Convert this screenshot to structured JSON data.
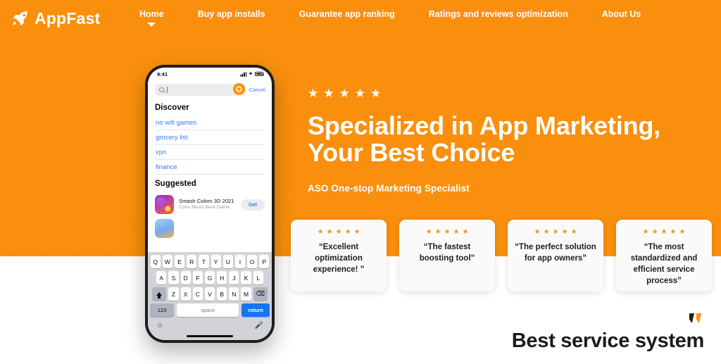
{
  "brand": {
    "name": "AppFast",
    "icon": "rocket-icon",
    "color": "#ffffff"
  },
  "theme": {
    "orange": "#f98f0c",
    "card_star": "#f9940f",
    "ios_blue": "#3a7afe",
    "return_key": "#1277f2"
  },
  "nav": {
    "items": [
      {
        "label": "Home",
        "has_caret": true
      },
      {
        "label": "Buy app installs",
        "has_caret": false
      },
      {
        "label": "Guarantee app ranking",
        "has_caret": false
      },
      {
        "label": "Ratings and reviews optimization",
        "has_caret": false
      },
      {
        "label": "About Us",
        "has_caret": false
      }
    ]
  },
  "hero": {
    "stars": "★★★★★",
    "star_count": 5,
    "title": "Specialized in App Marketing, Your Best Choice",
    "subtitle": "ASO One-stop Marketing Specialist"
  },
  "testimonials": [
    {
      "stars": 5,
      "text": "“Excellent optimization experience! ”"
    },
    {
      "stars": 5,
      "text": "“The fastest boosting tool”"
    },
    {
      "stars": 5,
      "text": "“The perfect solution for app owners”"
    },
    {
      "stars": 5,
      "text": "“The most standardized and efficient service process”"
    }
  ],
  "footer_block": {
    "heading": "Best service system",
    "quote_icon": "quote-mark-icon"
  },
  "phone": {
    "status_bar": {
      "time": "9:41",
      "signal": "signal-bars-icon",
      "wifi": "wifi-icon",
      "battery": "battery-icon"
    },
    "search": {
      "placeholder": "",
      "value": "",
      "cancel_label": "Cancel",
      "cursor_overlay": "pointer-ring-icon"
    },
    "discover": {
      "title": "Discover",
      "terms": [
        "no wifi games",
        "grocery list",
        "vpn",
        "finance"
      ]
    },
    "suggested": {
      "title": "Suggested",
      "apps": [
        {
          "name": "Smash Colors 3D 2021",
          "subtitle": "Color Music Beat Game",
          "action": "Get"
        }
      ]
    },
    "keyboard": {
      "row1": [
        "Q",
        "W",
        "E",
        "R",
        "T",
        "Y",
        "U",
        "I",
        "O",
        "P"
      ],
      "row2": [
        "A",
        "S",
        "D",
        "F",
        "G",
        "H",
        "J",
        "K",
        "L"
      ],
      "row3": [
        "Z",
        "X",
        "C",
        "V",
        "B",
        "N",
        "M"
      ],
      "shift": "shift-icon",
      "backspace": "backspace-icon",
      "numbers_key": "123",
      "space_key": "space",
      "return_key": "return",
      "emoji": "emoji-icon",
      "mic": "microphone-icon"
    }
  }
}
